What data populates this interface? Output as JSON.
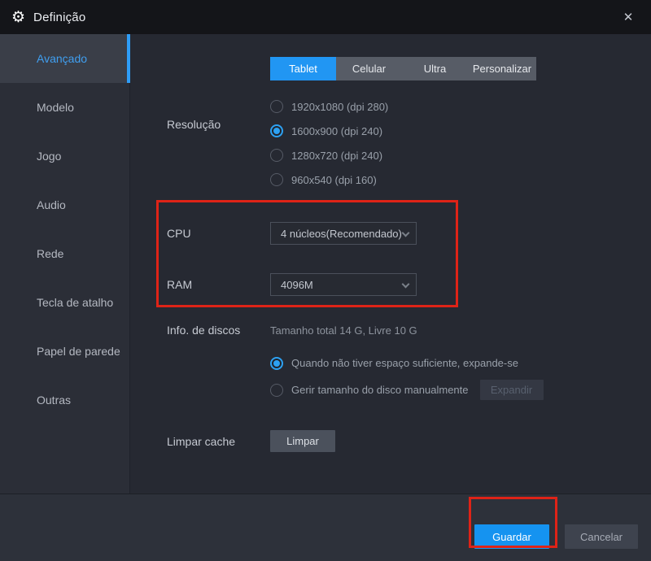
{
  "window": {
    "title": "Definição",
    "gear_icon": "⚙",
    "close_icon": "✕"
  },
  "sidebar": {
    "items": [
      {
        "label": "Avançado",
        "selected": true
      },
      {
        "label": "Modelo",
        "selected": false
      },
      {
        "label": "Jogo",
        "selected": false
      },
      {
        "label": "Audio",
        "selected": false
      },
      {
        "label": "Rede",
        "selected": false
      },
      {
        "label": "Tecla de atalho",
        "selected": false
      },
      {
        "label": "Papel de parede",
        "selected": false
      },
      {
        "label": "Outras",
        "selected": false
      }
    ]
  },
  "content": {
    "resolution": {
      "label": "Resolução",
      "tabs": [
        {
          "label": "Tablet",
          "selected": true
        },
        {
          "label": "Celular",
          "selected": false
        },
        {
          "label": "Ultra",
          "selected": false
        },
        {
          "label": "Personalizar",
          "selected": false
        }
      ],
      "options": [
        {
          "label": "1920x1080  (dpi 280)",
          "selected": false
        },
        {
          "label": "1600x900  (dpi 240)",
          "selected": true
        },
        {
          "label": "1280x720  (dpi 240)",
          "selected": false
        },
        {
          "label": "960x540  (dpi 160)",
          "selected": false
        }
      ]
    },
    "cpu": {
      "label": "CPU",
      "value": "4 núcleos(Recomendado)"
    },
    "ram": {
      "label": "RAM",
      "value": "4096M"
    },
    "disk": {
      "label": "Info. de discos",
      "summary": "Tamanho total 14 G,  Livre 10 G",
      "options": [
        {
          "label": "Quando não tiver espaço suficiente, expande-se",
          "selected": true
        },
        {
          "label": "Gerir tamanho do disco manualmente",
          "selected": false
        }
      ],
      "expand_button": "Expandir"
    },
    "cache": {
      "label": "Limpar cache",
      "button": "Limpar"
    }
  },
  "footer": {
    "save_label": "Guardar",
    "cancel_label": "Cancelar"
  },
  "colors": {
    "accent_blue": "#2196f3",
    "annotation_red": "#de2317",
    "selected_text_blue": "#409ff0"
  }
}
